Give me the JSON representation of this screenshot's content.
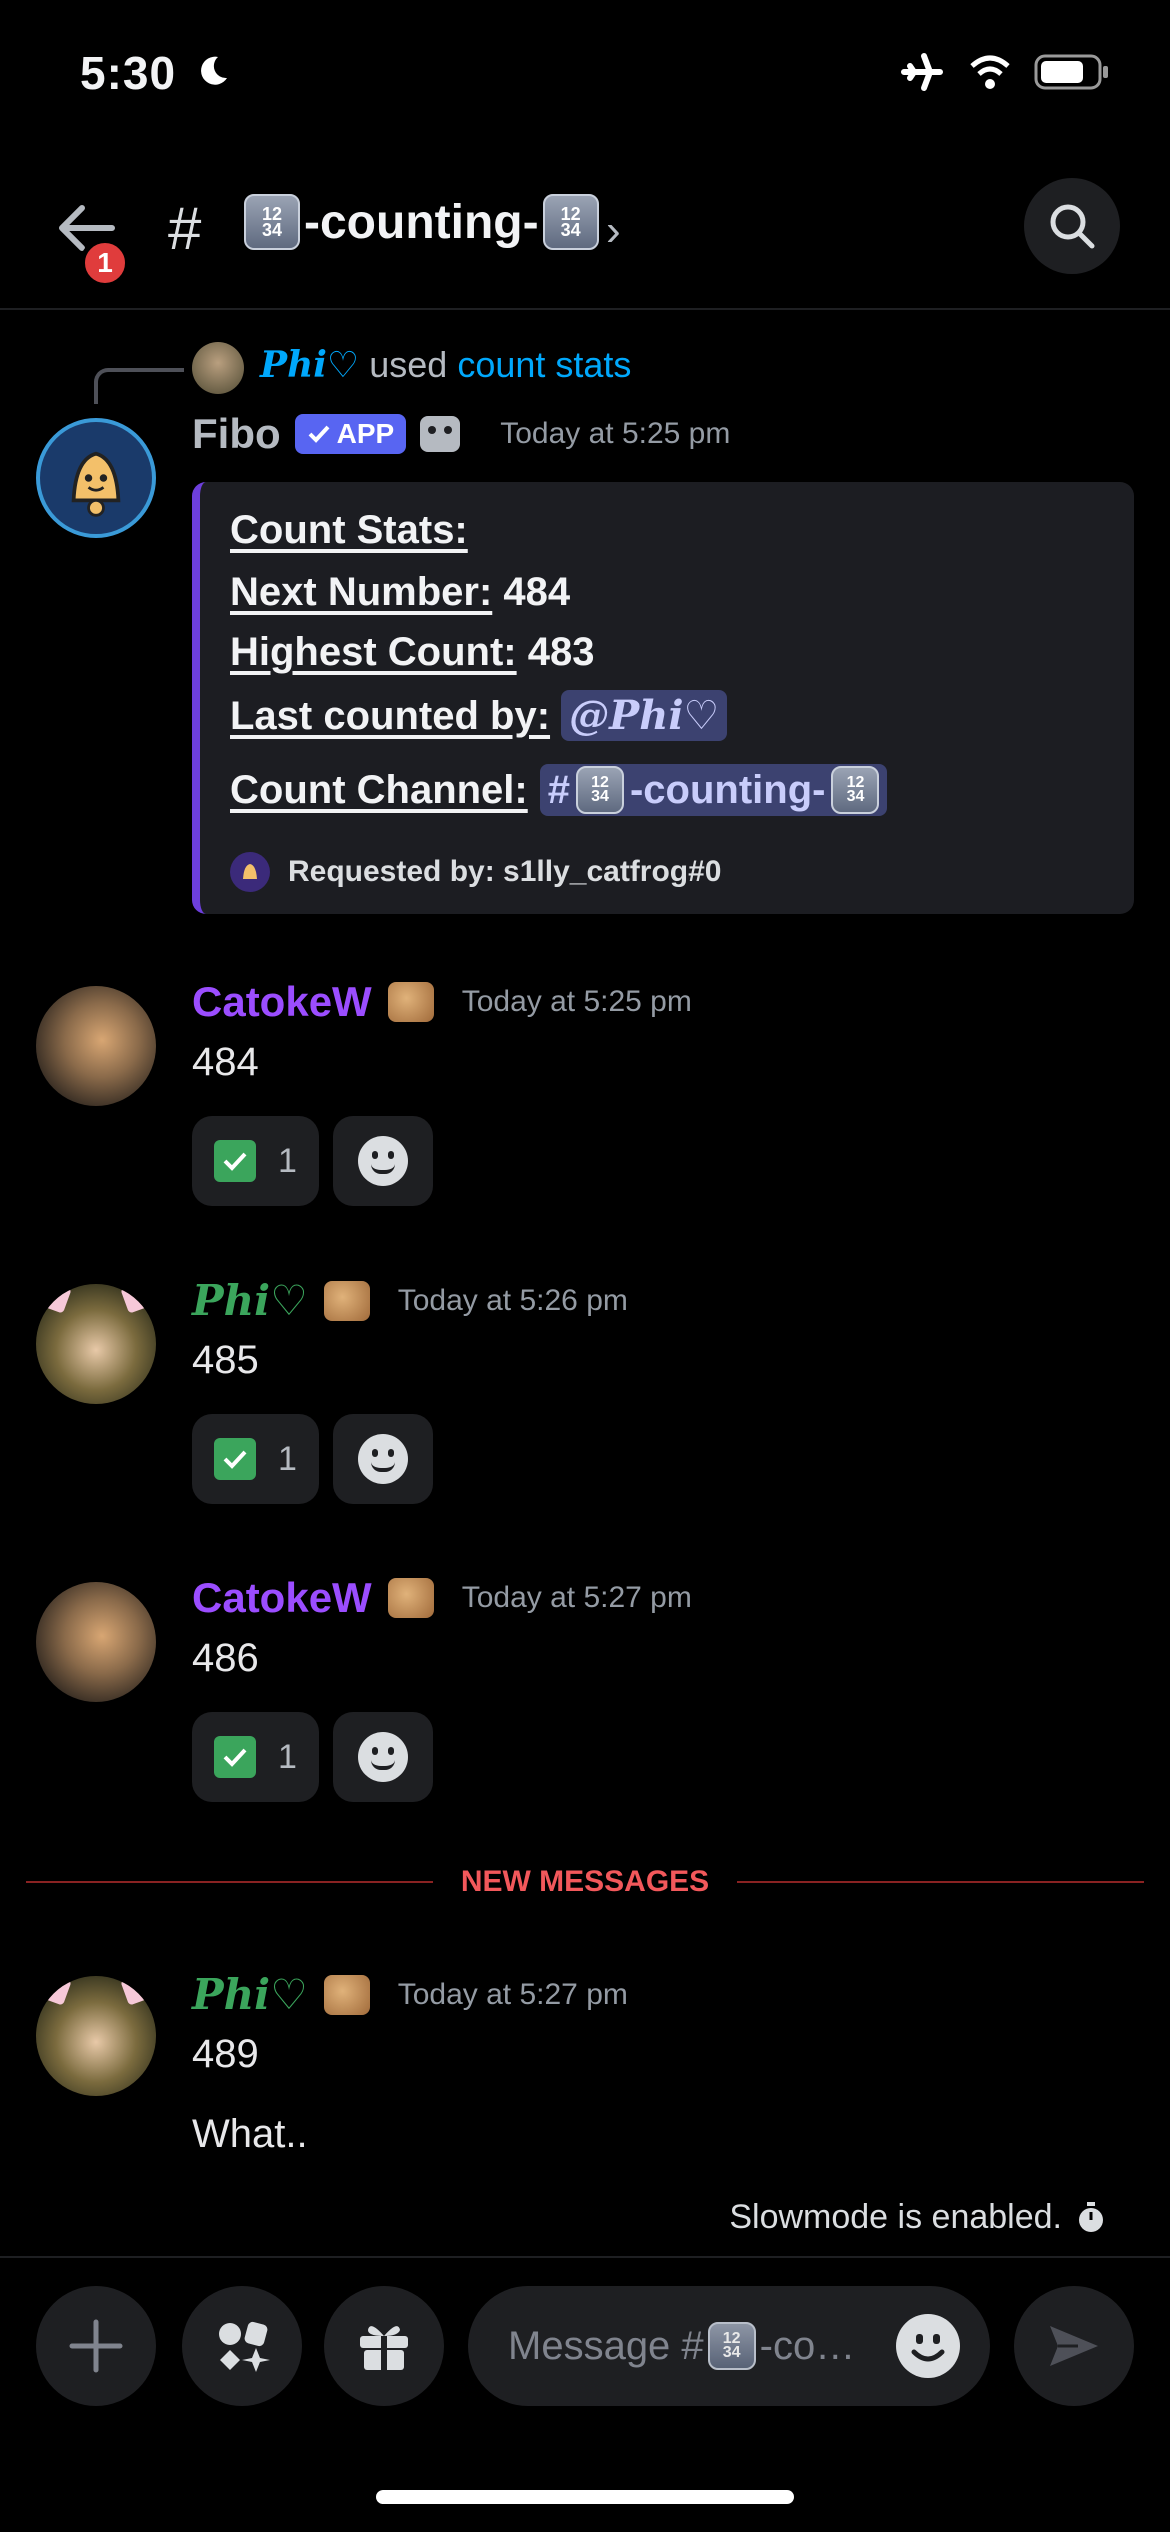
{
  "status_bar": {
    "time": "5:30"
  },
  "header": {
    "back_badge": "1",
    "hash": "#",
    "channel_keycap_top": "12",
    "channel_keycap_bottom": "34",
    "channel_name": "-counting-"
  },
  "reply_context": {
    "user": "Phi♡",
    "used": "used",
    "command": "count stats"
  },
  "messages": [
    {
      "author": "Fibo",
      "app_tag": "APP",
      "timestamp": "Today at 5:25 pm",
      "embed": {
        "title": "Count Stats:",
        "next_number_label": "Next Number:",
        "next_number": "484",
        "highest_label": "Highest Count:",
        "highest": "483",
        "last_label": "Last counted by:",
        "last_by": "@Phi♡",
        "channel_label": "Count Channel:",
        "channel_hash": "#",
        "channel_name": "-counting-",
        "footer": "Requested by: s1lly_catfrog#0"
      }
    },
    {
      "author": "CatokeW",
      "timestamp": "Today at 5:25 pm",
      "text": "484",
      "reaction_count": "1"
    },
    {
      "author": "Phi♡",
      "timestamp": "Today at 5:26 pm",
      "text": "485",
      "reaction_count": "1"
    },
    {
      "author": "CatokeW",
      "timestamp": "Today at 5:27 pm",
      "text": "486",
      "reaction_count": "1"
    },
    {
      "author": "Phi♡",
      "timestamp": "Today at 5:27 pm",
      "text": "489",
      "text2": "What.."
    }
  ],
  "divider": {
    "label": "NEW MESSAGES"
  },
  "slowmode": {
    "text": "Slowmode is enabled."
  },
  "composer": {
    "placeholder_prefix": "Message #",
    "placeholder_suffix": "-co…"
  },
  "colors": {
    "catokew": "#9b4dff",
    "phi_green": "#3ba55c",
    "phi_blue": "#00a8fc",
    "new_messages": "#f2585b",
    "app_tag": "#5865f2"
  },
  "icons": [
    "moon-icon",
    "airplane-icon",
    "wifi-icon",
    "battery-icon",
    "back-arrow-icon",
    "search-icon",
    "chevron-right-icon",
    "robot-icon",
    "check-icon",
    "add-reaction-icon",
    "timer-icon",
    "plus-icon",
    "apps-icon",
    "gift-icon",
    "emoji-icon",
    "send-icon"
  ]
}
